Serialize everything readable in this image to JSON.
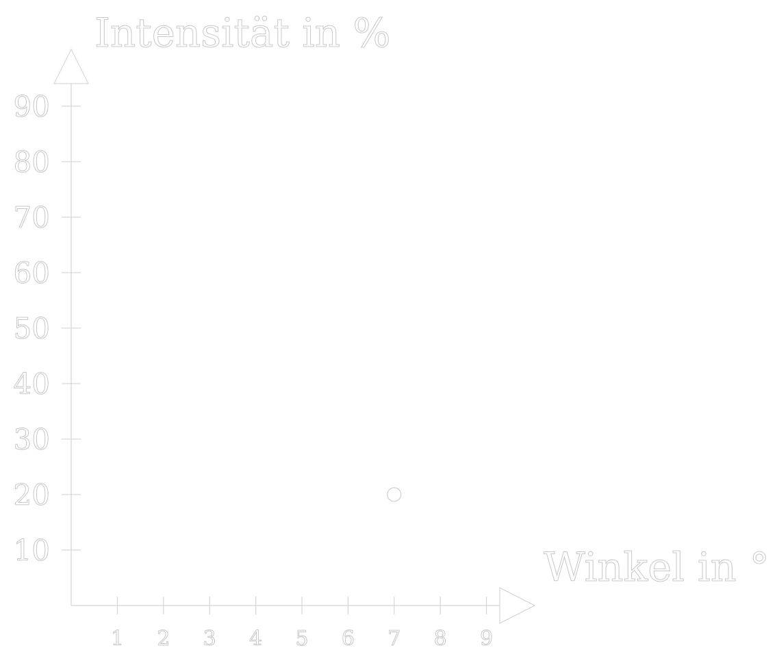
{
  "chart_data": {
    "type": "scatter",
    "ylabel": "Intensität in %",
    "xlabel": "Winkel in °",
    "xlim": [
      0,
      9
    ],
    "ylim": [
      0,
      90
    ],
    "x_ticks": [
      1,
      2,
      3,
      4,
      5,
      6,
      7,
      8,
      9
    ],
    "y_ticks": [
      10,
      20,
      30,
      40,
      50,
      60,
      70,
      80,
      90
    ],
    "x_tick_labels": [
      "1",
      "2",
      "3",
      "4",
      "5",
      "6",
      "7",
      "8",
      "9"
    ],
    "y_tick_labels": [
      "10",
      "20",
      "30",
      "40",
      "50",
      "60",
      "70",
      "80",
      "90"
    ],
    "grid": false,
    "series": [
      {
        "points": [
          {
            "x": 7,
            "y": 20
          }
        ]
      }
    ],
    "colors": {
      "background": "#ffffff",
      "stroke": "#cfcfcf",
      "text_outline": "#c8c8c8"
    }
  }
}
